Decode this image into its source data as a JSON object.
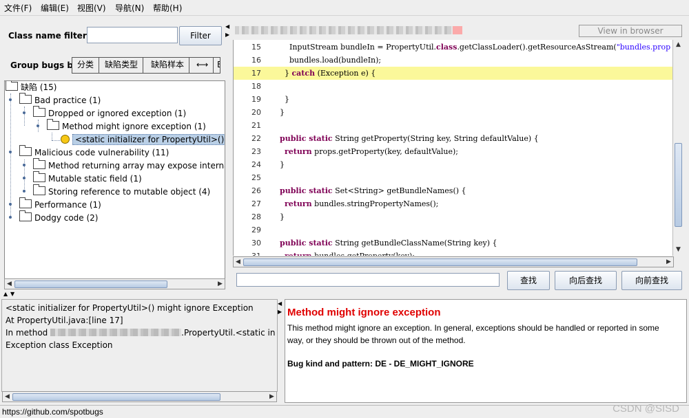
{
  "menu": [
    {
      "label": "文件(F)"
    },
    {
      "label": "编辑(E)"
    },
    {
      "label": "视图(V)"
    },
    {
      "label": "导航(N)"
    },
    {
      "label": "帮助(H)"
    }
  ],
  "filter": {
    "label": "Class name filter:",
    "value": "",
    "button": "Filter"
  },
  "group_by": {
    "label": "Group bugs by:",
    "options": [
      "分类",
      "缺陷类型",
      "缺陷样本",
      "⟷",
      "E"
    ]
  },
  "tree": {
    "root": "缺陷 (15)",
    "bad_practice": "Bad practice (1)",
    "dropped": "Dropped or ignored exception (1)",
    "might_ignore": "Method might ignore exception (1)",
    "selected_bug": "<static initializer for PropertyUtil>() might ignore Exception",
    "malicious": "Malicious code vulnerability (11)",
    "returning_array": "Method returning array may expose internal representation",
    "mutable_static": "Mutable static field (1)",
    "storing_ref": "Storing reference to mutable object (4)",
    "performance": "Performance (1)",
    "dodgy": "Dodgy code (2)"
  },
  "source_header": {
    "view_in_browser": "View in browser"
  },
  "code": [
    {
      "n": "15",
      "hl": false,
      "parts": [
        [
          "",
          "      InputStream bundleIn = PropertyUtil."
        ],
        [
          "kw",
          "class"
        ],
        [
          "",
          ".getClassLoader().getResourceAsStream("
        ],
        [
          "str",
          "\"bundles.prop"
        ]
      ]
    },
    {
      "n": "16",
      "hl": false,
      "parts": [
        [
          "",
          "      bundles.load(bundleIn);"
        ]
      ]
    },
    {
      "n": "17",
      "hl": true,
      "parts": [
        [
          "",
          "    } "
        ],
        [
          "kw",
          "catch"
        ],
        [
          "",
          " (Exception e) {"
        ]
      ]
    },
    {
      "n": "18",
      "hl": false,
      "parts": []
    },
    {
      "n": "19",
      "hl": false,
      "parts": [
        [
          "",
          "    }"
        ]
      ]
    },
    {
      "n": "20",
      "hl": false,
      "parts": [
        [
          "",
          "  }"
        ]
      ]
    },
    {
      "n": "21",
      "hl": false,
      "parts": []
    },
    {
      "n": "22",
      "hl": false,
      "parts": [
        [
          "",
          "  "
        ],
        [
          "kw",
          "public static"
        ],
        [
          "",
          " String getProperty(String key, String defaultValue) {"
        ]
      ]
    },
    {
      "n": "23",
      "hl": false,
      "parts": [
        [
          "",
          "    "
        ],
        [
          "kw",
          "return"
        ],
        [
          "",
          " props.getProperty(key, defaultValue);"
        ]
      ]
    },
    {
      "n": "24",
      "hl": false,
      "parts": [
        [
          "",
          "  }"
        ]
      ]
    },
    {
      "n": "25",
      "hl": false,
      "parts": []
    },
    {
      "n": "26",
      "hl": false,
      "parts": [
        [
          "",
          "  "
        ],
        [
          "kw",
          "public static"
        ],
        [
          "",
          " Set<String> getBundleNames() {"
        ]
      ]
    },
    {
      "n": "27",
      "hl": false,
      "parts": [
        [
          "",
          "    "
        ],
        [
          "kw",
          "return"
        ],
        [
          "",
          " bundles.stringPropertyNames();"
        ]
      ]
    },
    {
      "n": "28",
      "hl": false,
      "parts": [
        [
          "",
          "  }"
        ]
      ]
    },
    {
      "n": "29",
      "hl": false,
      "parts": []
    },
    {
      "n": "30",
      "hl": false,
      "parts": [
        [
          "",
          "  "
        ],
        [
          "kw",
          "public static"
        ],
        [
          "",
          " String getBundleClassName(String key) {"
        ]
      ]
    },
    {
      "n": "31",
      "hl": false,
      "parts": [
        [
          "",
          "    "
        ],
        [
          "kw",
          "return"
        ],
        [
          "",
          " bundles.getProperty(key);"
        ]
      ]
    }
  ],
  "search": {
    "value": "",
    "find": "查找",
    "find_next": "向后查找",
    "find_prev": "向前查找"
  },
  "summary": {
    "line1": "<static initializer for PropertyUtil>() might ignore Exception",
    "line2": "At PropertyUtil.java:[line 17]",
    "line3_prefix": "In method ",
    "line3_suffix": ".PropertyUtil.<static initializer for PropertyUtil>()",
    "line4": "Exception class Exception"
  },
  "description": {
    "title": "Method might ignore exception",
    "body": "This method might ignore an exception.  In general, exceptions should be handled or reported in some way, or they should be thrown out of the method.",
    "kind": "Bug kind and pattern: DE - DE_MIGHT_IGNORE"
  },
  "status": {
    "text": "https://github.com/spotbugs",
    "watermark": "CSDN @SISD"
  }
}
